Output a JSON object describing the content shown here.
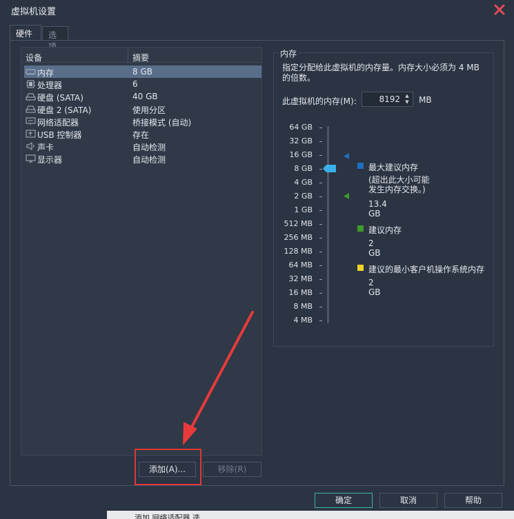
{
  "window": {
    "title": "虚拟机设置"
  },
  "tabs": [
    {
      "label": "硬件"
    },
    {
      "label": "选项"
    }
  ],
  "device_list": {
    "headers": {
      "device": "设备",
      "summary": "摘要"
    },
    "rows": [
      {
        "icon": "memory-icon",
        "name": "内存",
        "summary": "8 GB",
        "selected": true
      },
      {
        "icon": "processor-icon",
        "name": "处理器",
        "summary": "6"
      },
      {
        "icon": "hard-disk-icon",
        "name": "硬盘 (SATA)",
        "summary": "40 GB"
      },
      {
        "icon": "hard-disk-icon",
        "name": "硬盘 2 (SATA)",
        "summary": "使用分区"
      },
      {
        "icon": "network-adapter-icon",
        "name": "网络适配器",
        "summary": "桥接模式 (自动)"
      },
      {
        "icon": "usb-controller-icon",
        "name": "USB 控制器",
        "summary": "存在"
      },
      {
        "icon": "sound-card-icon",
        "name": "声卡",
        "summary": "自动检测"
      },
      {
        "icon": "display-icon",
        "name": "显示器",
        "summary": "自动检测"
      }
    ],
    "add_button": "添加(A)...",
    "remove_button": "移除(R)"
  },
  "memory": {
    "group_title": "内存",
    "description": "指定分配给此虚拟机的内存量。内存大小必须为 4 MB 的倍数。",
    "field_label": "此虚拟机的内存(M):",
    "value": "8192",
    "unit": "MB",
    "scale": [
      "64 GB",
      "32 GB",
      "16 GB",
      "8 GB",
      "4 GB",
      "2 GB",
      "1 GB",
      "512 MB",
      "256 MB",
      "128 MB",
      "64 MB",
      "32 MB",
      "16 MB",
      "8 MB",
      "4 MB"
    ],
    "selected_level": "8 GB",
    "legend": {
      "max": {
        "title": "最大建议内存",
        "note_line1": "(超出此大小可能",
        "note_line2": "发生内存交换。)",
        "value": "13.4 GB",
        "color": "#1e6fc0"
      },
      "recommended": {
        "title": "建议内存",
        "value": "2 GB",
        "color": "#3e9b2a"
      },
      "min": {
        "title": "建议的最小客户机操作系统内存",
        "value": "2 GB",
        "color": "#f2d22c"
      }
    }
  },
  "footer": {
    "ok": "确定",
    "cancel": "取消",
    "help": "帮助"
  },
  "background_peek": "添加 网络适配器  选"
}
